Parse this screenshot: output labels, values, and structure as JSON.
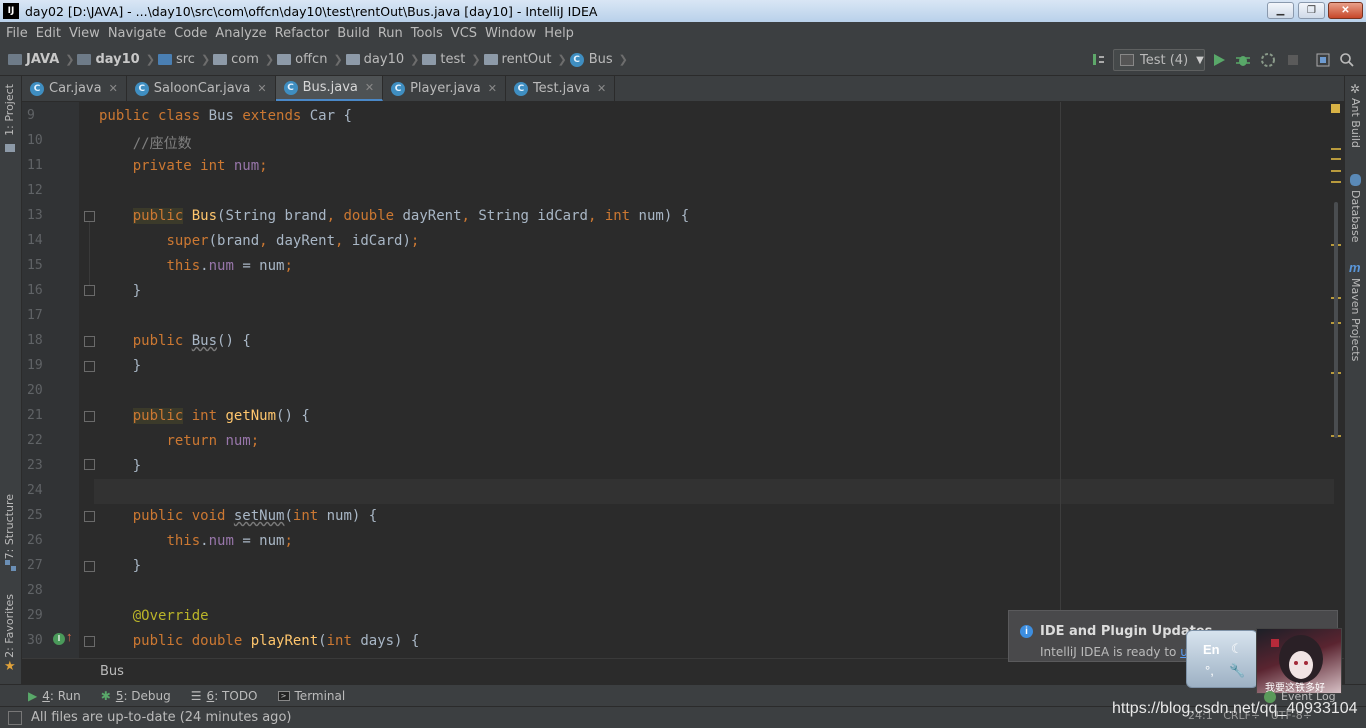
{
  "window": {
    "title": "day02 [D:\\JAVA] - ...\\day10\\src\\com\\offcn\\day10\\test\\rentOut\\Bus.java [day10] - IntelliJ IDEA",
    "app_icon": "IJ"
  },
  "menu": [
    "File",
    "Edit",
    "View",
    "Navigate",
    "Code",
    "Analyze",
    "Refactor",
    "Build",
    "Run",
    "Tools",
    "VCS",
    "Window",
    "Help"
  ],
  "breadcrumbs": [
    "JAVA",
    "day10",
    "src",
    "com",
    "offcn",
    "day10",
    "test",
    "rentOut",
    "Bus"
  ],
  "run_config": "Test (4)",
  "tabs": [
    {
      "label": "Car.java",
      "active": false
    },
    {
      "label": "SaloonCar.java",
      "active": false
    },
    {
      "label": "Bus.java",
      "active": true
    },
    {
      "label": "Player.java",
      "active": false
    },
    {
      "label": "Test.java",
      "active": false
    }
  ],
  "left_tools": [
    "1: Project",
    "7: Structure",
    "2: Favorites"
  ],
  "right_tools": [
    "Ant Build",
    "Database",
    "Maven Projects"
  ],
  "line_numbers": [
    "9",
    "10",
    "11",
    "12",
    "13",
    "14",
    "15",
    "16",
    "17",
    "18",
    "19",
    "20",
    "21",
    "22",
    "23",
    "24",
    "25",
    "26",
    "27",
    "28",
    "29",
    "30"
  ],
  "editor_breadcrumb": "Bus",
  "tool_windows": [
    {
      "key": "4",
      "label": ": Run",
      "icon": "run-icon"
    },
    {
      "key": "5",
      "label": ": Debug",
      "icon": "debug-icon"
    },
    {
      "key": "6",
      "label": ": TODO",
      "icon": "todo-icon"
    },
    {
      "key": "",
      "label": "Terminal",
      "icon": "terminal-icon"
    }
  ],
  "status": {
    "message": "All files are up-to-date (24 minutes ago)",
    "position": "24:1",
    "line_sep": "CRLF÷",
    "encoding": "UTF-8÷"
  },
  "notification": {
    "title": "IDE and Plugin Updates",
    "body": "IntelliJ IDEA is ready to ",
    "link": "u"
  },
  "ime": {
    "lang": "En"
  },
  "avatar_caption": "我要这铁多好",
  "event_log": "Event Log",
  "watermark": "https://blog.csdn.net/qq_40933104",
  "colors": {
    "keyword": "#cc7832",
    "comment": "#808080",
    "field": "#9876aa",
    "method": "#ffc66d",
    "annotation": "#bbb529",
    "editor_bg": "#2b2b2b",
    "ui_bg": "#3c3f41"
  }
}
